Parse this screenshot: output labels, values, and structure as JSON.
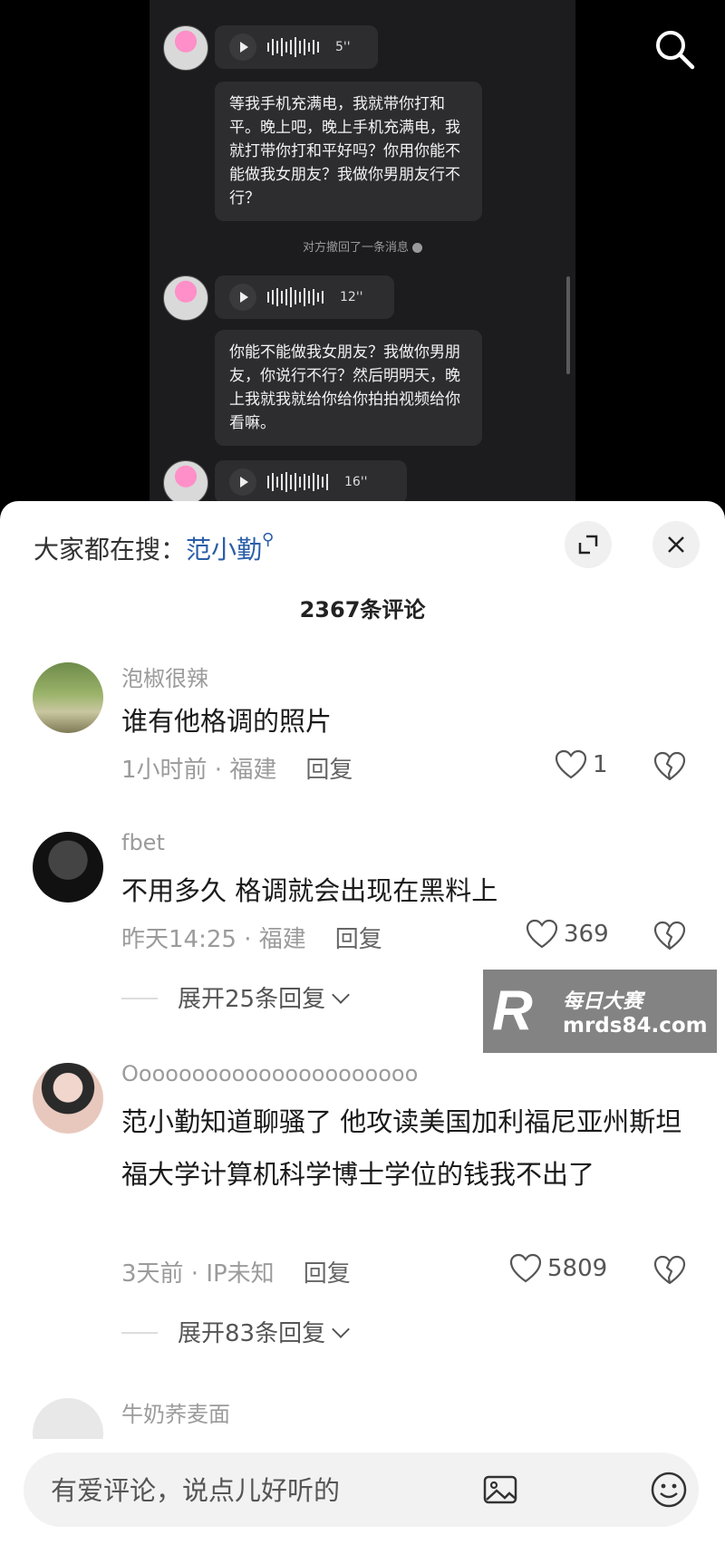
{
  "chat": {
    "voice_1_duration": "5''",
    "message_1": "等我手机充满电，我就带你打和平。晚上吧，晚上手机充满电，我就打带你打和平好吗？你用你能不能做我女朋友？我做你男朋友行不行？",
    "recall_notice": "对方撤回了一条消息",
    "voice_2_duration": "12''",
    "message_2": "你能不能做我女朋友？我做你男朋友，你说行不行？然后明明天，晚上我就我就给你给你拍拍视频给你看嘛。",
    "voice_3_duration": "16''"
  },
  "sheet": {
    "hot_search_label": "大家都在搜：",
    "hot_search_term": "范小勤",
    "comment_count": "2367条评论"
  },
  "comments": [
    {
      "user": "泡椒很辣",
      "text": "谁有他格调的照片",
      "time_location": "1小时前 · 福建",
      "reply_label": "回复",
      "likes": "1"
    },
    {
      "user": "fbet",
      "text": "不用多久 格调就会出现在黑料上",
      "time_location": "昨天14:25 · 福建",
      "reply_label": "回复",
      "likes": "369",
      "expand_label": "展开25条回复"
    },
    {
      "user": "Oooooooooooooooooooooo",
      "text": "范小勤知道聊骚了 他攻读美国加利福尼亚州斯坦福大学计算机科学博士学位的钱我不出了",
      "time_location": "3天前 · IP未知",
      "reply_label": "回复",
      "likes": "5809",
      "expand_label": "展开83条回复"
    },
    {
      "user": "牛奶荞麦面"
    }
  ],
  "input": {
    "placeholder": "有爱评论，说点儿好听的"
  },
  "watermark": {
    "title": "每日大赛",
    "url": "mrds84.com"
  },
  "icons": {
    "search": "search-icon",
    "expand": "expand-icon",
    "close": "close-icon",
    "like": "heart-icon",
    "dislike": "broken-heart-icon",
    "image": "image-icon",
    "emoji": "emoji-icon"
  }
}
